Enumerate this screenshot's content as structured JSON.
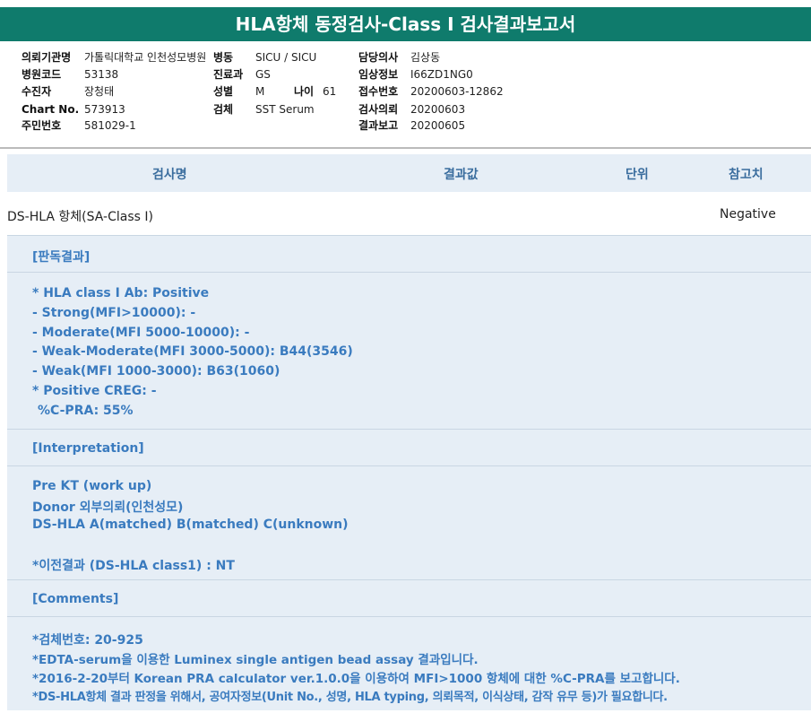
{
  "title": "HLA항체 동정검사-Class I 검사결과보고서",
  "info": {
    "institution_label": "의뢰기관명",
    "institution": "가톨릭대학교 인천성모병원",
    "hospital_code_label": "병원코드",
    "hospital_code": "53138",
    "collector_label": "수진자",
    "collector": "장청태",
    "chart_label": "Chart No.",
    "chart": "573913",
    "resident_label": "주민번호",
    "resident": "581029-1",
    "ward_label": "병동",
    "ward": "SICU / SICU",
    "dept_label": "진료과",
    "dept": "GS",
    "sex_label": "성별",
    "sex": "M",
    "age_label": "나이",
    "age": "61",
    "specimen_label": "검체",
    "specimen": "SST Serum",
    "doctor_label": "담당의사",
    "doctor": "김상동",
    "clinical_label": "임상정보",
    "clinical": "I66ZD1NG0",
    "receipt_label": "접수번호",
    "receipt": "20200603-12862",
    "request_label": "검사의뢰",
    "request": "20200603",
    "report_label": "결과보고",
    "report": "20200605"
  },
  "table": {
    "headers": {
      "name": "검사명",
      "result": "결과값",
      "unit": "단위",
      "reference": "참고치"
    },
    "row": {
      "name": "DS-HLA 항체(SA-Class I)",
      "result": "",
      "unit": "",
      "reference": "Negative"
    }
  },
  "sections": {
    "judgement_title": "[판독결과]",
    "judgement_lines": [
      "* HLA class I Ab: Positive",
      "- Strong(MFI>10000): -",
      "- Moderate(MFI 5000-10000): -",
      "- Weak-Moderate(MFI 3000-5000): B44(3546)",
      "- Weak(MFI 1000-3000): B63(1060)",
      "* Positive CREG: -",
      " %C-PRA: 55%"
    ],
    "interpretation_title": "[Interpretation]",
    "interpretation_lines": [
      "Pre KT (work up)",
      "Donor 외부의뢰(인천성모)",
      "DS-HLA A(matched) B(matched) C(unknown)",
      "",
      "*이전결과 (DS-HLA class1) : NT"
    ],
    "comments_title": "[Comments]",
    "comments_lines": [
      "*검체번호: 20-925",
      "*EDTA-serum을 이용한 Luminex single antigen bead assay 결과입니다.",
      "*2016-2-20부터 Korean PRA calculator ver.1.0.0을 이용하여 MFI>1000 항체에 대한 %C-PRA를 보고합니다.",
      "*DS-HLA항체 결과 판정을 위해서, 공여자정보(Unit No., 성명, HLA typing, 의뢰목적, 이식상태, 감작 유무 등)가 필요합니다."
    ]
  },
  "colors": {
    "title_bg": "#0f7b6c",
    "section_bg": "#e6eef6",
    "section_text": "#3a7bbf"
  }
}
